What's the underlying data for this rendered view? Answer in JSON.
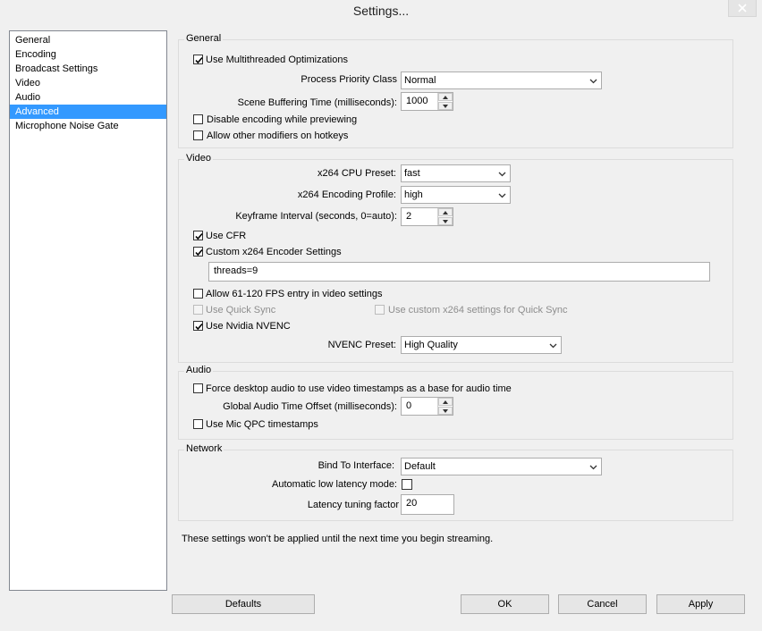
{
  "window": {
    "title": "Settings...",
    "close_icon": "close-icon"
  },
  "nav": {
    "items": [
      "General",
      "Encoding",
      "Broadcast Settings",
      "Video",
      "Audio",
      "Advanced",
      "Microphone Noise Gate"
    ],
    "selected": "Advanced"
  },
  "general": {
    "title": "General",
    "multithreaded": {
      "label": "Use Multithreaded Optimizations",
      "checked": true
    },
    "priority": {
      "label": "Process Priority Class",
      "value": "Normal"
    },
    "buffering": {
      "label": "Scene Buffering Time (milliseconds):",
      "value": "1000"
    },
    "disable_preview": {
      "label": "Disable encoding while previewing",
      "checked": false
    },
    "modifiers": {
      "label": "Allow other modifiers on hotkeys",
      "checked": false
    }
  },
  "video": {
    "title": "Video",
    "cpu_preset": {
      "label": "x264 CPU Preset:",
      "value": "fast"
    },
    "profile": {
      "label": "x264 Encoding Profile:",
      "value": "high"
    },
    "keyframe": {
      "label": "Keyframe Interval (seconds, 0=auto):",
      "value": "2"
    },
    "cfr": {
      "label": "Use CFR",
      "checked": true
    },
    "custom_x264": {
      "label": "Custom x264 Encoder Settings",
      "checked": true
    },
    "custom_x264_value": "threads=9",
    "fps_entry": {
      "label": "Allow 61-120 FPS entry in video settings",
      "checked": false
    },
    "quick_sync": {
      "label": "Use Quick Sync",
      "checked": false,
      "disabled": true
    },
    "quick_sync_custom": {
      "label": "Use custom x264 settings for Quick Sync",
      "checked": false,
      "disabled": true
    },
    "nvenc": {
      "label": "Use Nvidia NVENC",
      "checked": true
    },
    "nvenc_preset": {
      "label": "NVENC Preset:",
      "value": "High Quality"
    }
  },
  "audio": {
    "title": "Audio",
    "force_desktop": {
      "label": "Force desktop audio to use video timestamps as a base for audio time",
      "checked": false
    },
    "offset": {
      "label": "Global Audio Time Offset (milliseconds):",
      "value": "0"
    },
    "mic_qpc": {
      "label": "Use Mic QPC timestamps",
      "checked": false
    }
  },
  "network": {
    "title": "Network",
    "bind": {
      "label": "Bind To Interface:",
      "value": "Default"
    },
    "low_latency": {
      "label": "Automatic low latency mode:",
      "checked": false
    },
    "latency_factor": {
      "label": "Latency tuning factor",
      "value": "20"
    }
  },
  "notice": "These settings won't be applied until the next time you begin streaming.",
  "buttons": {
    "defaults": "Defaults",
    "ok": "OK",
    "cancel": "Cancel",
    "apply": "Apply"
  }
}
